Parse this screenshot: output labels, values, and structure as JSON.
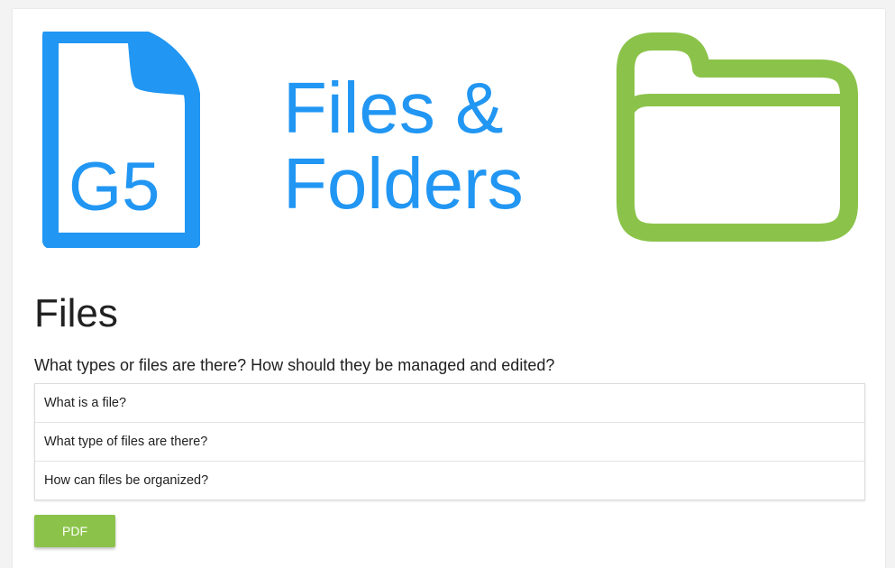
{
  "hero": {
    "doc_icon_label": "G5",
    "title_line1": "Files &",
    "title_line2": "Folders"
  },
  "section": {
    "title": "Files",
    "description": "What types or files are there? How should they be managed and edited?"
  },
  "list": {
    "items": [
      "What is a file?",
      "What type of files are there?",
      "How can files be organized?"
    ]
  },
  "actions": {
    "pdf_label": "PDF"
  },
  "icons": {
    "document": "document-icon",
    "folder": "folder-icon"
  },
  "colors": {
    "primary_blue": "#2196f3",
    "accent_green": "#8bc34a",
    "text": "#212121"
  }
}
